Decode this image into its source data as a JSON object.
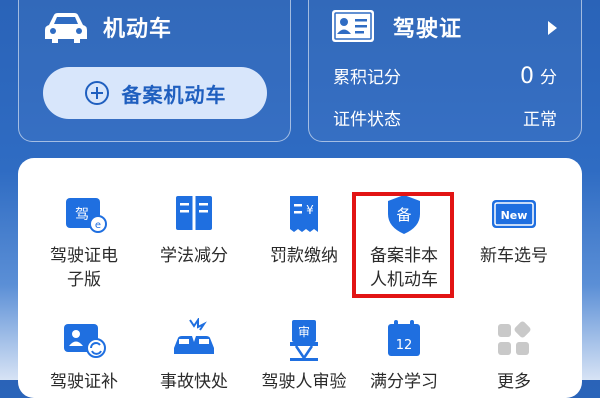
{
  "vehicle_card": {
    "title": "机动车",
    "register_button": "备案机动车",
    "icon": "car-icon"
  },
  "license_card": {
    "title": "驾驶证",
    "icon": "id-card-icon",
    "points_label": "累积记分",
    "points_value": "0",
    "points_unit": "分",
    "status_label": "证件状态",
    "status_value": "正常"
  },
  "services": {
    "row1": [
      {
        "label": "驾驶证电\n子版",
        "icon": "e-license-icon"
      },
      {
        "label": "学法减分",
        "icon": "book-icon"
      },
      {
        "label": "罚款缴纳",
        "icon": "fine-receipt-icon"
      },
      {
        "label": "备案非本\n人机动车",
        "icon": "shield-badge-icon"
      },
      {
        "label": "新车选号",
        "icon": "new-plate-icon"
      }
    ],
    "row2": [
      {
        "label": "驾驶证补",
        "icon": "license-renew-icon"
      },
      {
        "label": "事故快处",
        "icon": "accident-icon"
      },
      {
        "label": "驾驶人审验",
        "icon": "driver-review-icon"
      },
      {
        "label": "满分学习",
        "icon": "calendar-12-icon",
        "calendar_number": "12"
      },
      {
        "label": "更多",
        "icon": "more-grid-icon"
      }
    ]
  },
  "colors": {
    "accent_blue": "#1f6fe0",
    "highlight_red": "#e21414"
  }
}
